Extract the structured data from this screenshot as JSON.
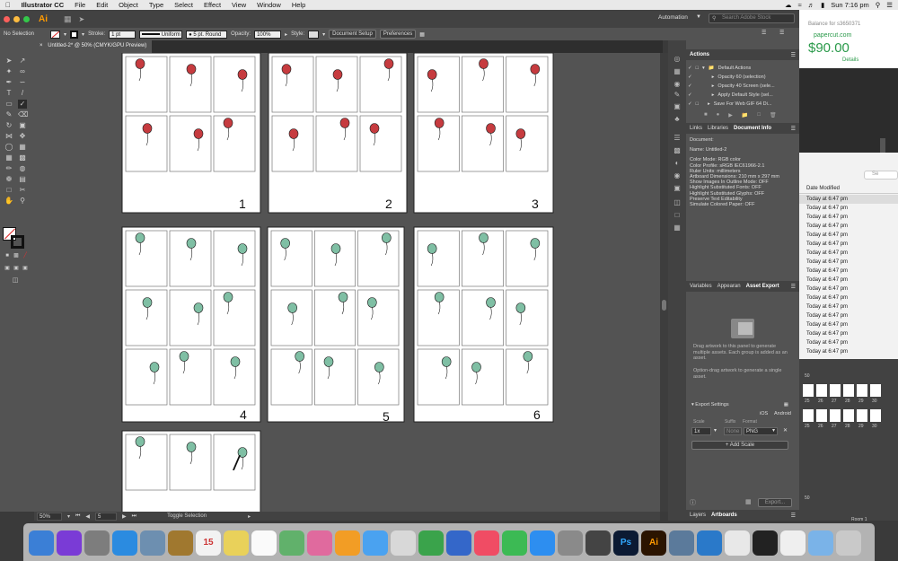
{
  "menubar": {
    "app_name": "Illustrator CC",
    "items": [
      "File",
      "Edit",
      "Object",
      "Type",
      "Select",
      "Effect",
      "View",
      "Window",
      "Help"
    ],
    "clock": "Sun 7:16 pm"
  },
  "app": {
    "logo": "Ai",
    "automation_label": "Automation",
    "search_placeholder": "Search Adobe Stock"
  },
  "control_bar": {
    "selection": "No Selection",
    "stroke_label": "Stroke:",
    "stroke_value": "1 pt",
    "profile": "Uniform",
    "brush": "5 pt. Round",
    "opacity_label": "Opacity:",
    "opacity_value": "100%",
    "style_label": "Style:",
    "document_setup": "Document Setup",
    "preferences": "Preferences"
  },
  "document_tab": {
    "title": "Untitled-2* @ 50% (CMYK/GPU Preview)",
    "close": "×"
  },
  "artboards": [
    {
      "number": "1",
      "balloon_color": "#c63b3f"
    },
    {
      "number": "2",
      "balloon_color": "#c63b3f"
    },
    {
      "number": "3",
      "balloon_color": "#c63b3f"
    },
    {
      "number": "4",
      "balloon_color": "#7fbfa4"
    },
    {
      "number": "5",
      "balloon_color": "#7fbfa4"
    },
    {
      "number": "6",
      "balloon_color": "#7fbfa4"
    },
    {
      "number": "",
      "balloon_color": "#7fbfa4"
    }
  ],
  "artboard7_mark": "/",
  "status_bar": {
    "zoom": "50%",
    "artboard_nav": "5",
    "mode": "Toggle Selection"
  },
  "actions_panel": {
    "title": "Actions",
    "folder": "Default Actions",
    "items": [
      "Opacity 60 (selection)",
      "Opacity 40 Screen (sele...",
      "Apply Default Style (sel...",
      "Save For Web GIF 64 Di..."
    ]
  },
  "info_panel": {
    "tabs": [
      "Links",
      "Libraries",
      "Document Info"
    ],
    "active_tab": "Document Info",
    "heading": "Document:",
    "name": "Name: Untitled-2",
    "lines": [
      "Color Mode: RGB color",
      "Color Profile: sRGB IEC61966-2.1",
      "Ruler Units: millimeters",
      "Artboard Dimensions: 210 mm x 297 mm",
      "Show Images In Outline Mode: OFF",
      "Highlight Substituted Fonts: OFF",
      "Highlight Substituted Glyphs: OFF",
      "Preserve Text Editability",
      "Simulate Colored Paper: OFF"
    ]
  },
  "asset_panel": {
    "tabs": [
      "Variables",
      "Appearan",
      "Asset Export"
    ],
    "active_tab": "Asset Export",
    "drag_text": "Drag artwork to this panel to generate multiple assets. Each group is added as an asset.",
    "option_text": "Option-drag artwork to generate a single asset.",
    "export_settings": "Export Settings",
    "ios": "iOS",
    "android": "Android",
    "scale_label": "Scale",
    "suffix_label": "Suffix",
    "format_label": "Format",
    "scale_value": "1x",
    "suffix_placeholder": "None",
    "format_value": "PNG",
    "add_scale": "+ Add Scale",
    "export_button": "Export..."
  },
  "bottom_tabs": [
    "Layers",
    "Artboards"
  ],
  "active_bottom_tab": "Artboards",
  "paypal_widget": {
    "balance_label": "Balance for s3650371",
    "site": "papercut.com",
    "amount": "$90.00",
    "details": "Details"
  },
  "finder": {
    "column": "Date Modified",
    "rows": [
      "Today at 6:47 pm",
      "Today at 6:47 pm",
      "Today at 6:47 pm",
      "Today at 6:47 pm",
      "Today at 6:47 pm",
      "Today at 6:47 pm",
      "Today at 6:47 pm",
      "Today at 6:47 pm",
      "Today at 6:47 pm",
      "Today at 6:47 pm",
      "Today at 6:47 pm",
      "Today at 6:47 pm",
      "Today at 6:47 pm",
      "Today at 6:47 pm",
      "Today at 6:47 pm",
      "Today at 6:47 pm",
      "Today at 6:47 pm",
      "Today at 6:47 pm"
    ],
    "thumb_numbers_a": "50",
    "thumb_numbers_b": [
      "25",
      "26",
      "27",
      "28",
      "29",
      "30"
    ],
    "room_label": "Room 1"
  },
  "dock": {
    "apps": [
      {
        "name": "finder-icon",
        "color": "#3b7fd6",
        "label": ""
      },
      {
        "name": "siri-icon",
        "color": "#7a3bd6",
        "label": ""
      },
      {
        "name": "launchpad-icon",
        "color": "#7d7d7d",
        "label": ""
      },
      {
        "name": "safari-icon",
        "color": "#2b8be0",
        "label": ""
      },
      {
        "name": "preview-icon",
        "color": "#6d8fb0",
        "label": ""
      },
      {
        "name": "notes-icon",
        "color": "#a0782f",
        "label": ""
      },
      {
        "name": "calendar-icon",
        "color": "#f2f2f2",
        "label": "15"
      },
      {
        "name": "stickies-icon",
        "color": "#e9d15a",
        "label": ""
      },
      {
        "name": "reminders-icon",
        "color": "#fafafa",
        "label": ""
      },
      {
        "name": "maps-icon",
        "color": "#61b16b",
        "label": ""
      },
      {
        "name": "photos-icon",
        "color": "#e06a9e",
        "label": ""
      },
      {
        "name": "ibooks-icon",
        "color": "#f29d25",
        "label": ""
      },
      {
        "name": "messages-icon",
        "color": "#4aa2f0",
        "label": ""
      },
      {
        "name": "textedit-icon",
        "color": "#d8d8d8",
        "label": ""
      },
      {
        "name": "numbers-icon",
        "color": "#3aa34b",
        "label": ""
      },
      {
        "name": "keynote-icon",
        "color": "#3467c9",
        "label": ""
      },
      {
        "name": "music-icon",
        "color": "#f04c64",
        "label": ""
      },
      {
        "name": "facetime-icon",
        "color": "#3cba54",
        "label": ""
      },
      {
        "name": "appstore-icon",
        "color": "#2d8ef0",
        "label": ""
      },
      {
        "name": "system-preferences-icon",
        "color": "#8a8a8a",
        "label": ""
      },
      {
        "name": "butterfly-icon",
        "color": "#444444",
        "label": ""
      },
      {
        "name": "photoshop-icon",
        "color": "#0b1a33",
        "label": "Ps"
      },
      {
        "name": "illustrator-icon",
        "color": "#2b1400",
        "label": "Ai"
      },
      {
        "name": "image-capture-icon",
        "color": "#5b7a9b",
        "label": ""
      },
      {
        "name": "globe-icon",
        "color": "#2a79c9",
        "label": ""
      },
      {
        "name": "money-icon",
        "color": "#e8e8e8",
        "label": ""
      },
      {
        "name": "screen-icon",
        "color": "#222222",
        "label": ""
      },
      {
        "name": "stacks-icon",
        "color": "#efefef",
        "label": ""
      },
      {
        "name": "folder-icon",
        "color": "#7ab3e8",
        "label": ""
      },
      {
        "name": "trash-icon",
        "color": "#c9c9c9",
        "label": ""
      }
    ]
  }
}
